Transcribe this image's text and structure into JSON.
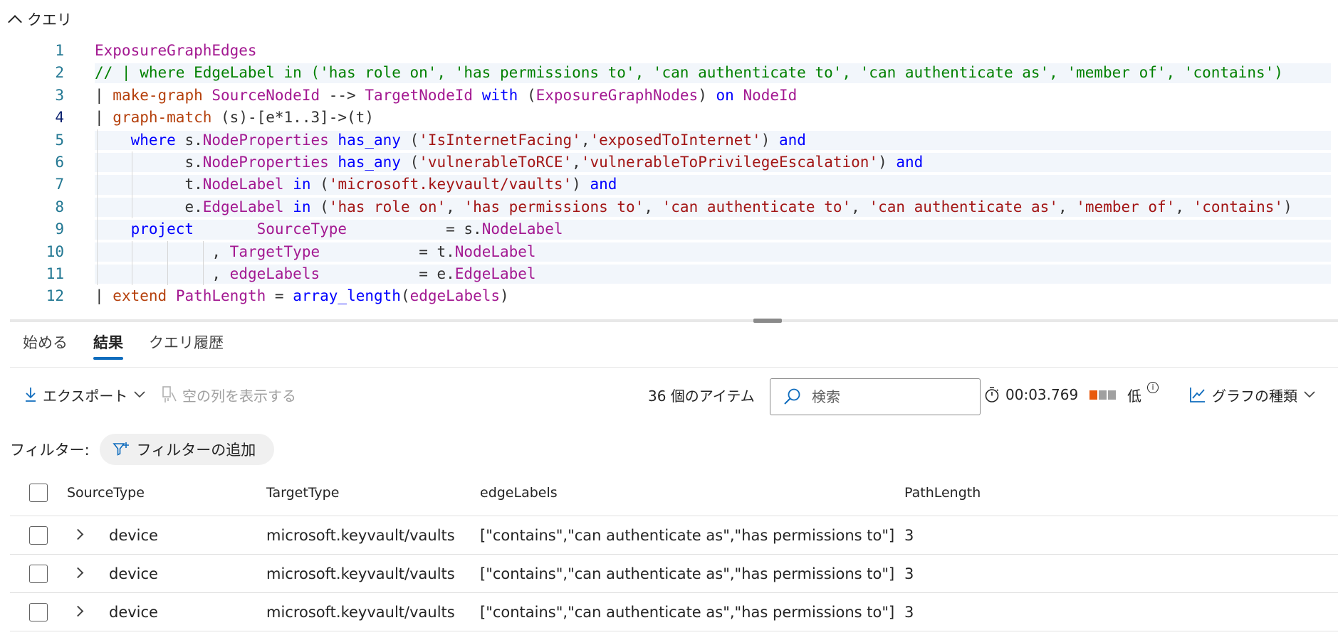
{
  "query_section": {
    "title": "クエリ"
  },
  "editor": {
    "line_numbers": [
      "1",
      "2",
      "3",
      "4",
      "5",
      "6",
      "7",
      "8",
      "9",
      "10",
      "11",
      "12"
    ]
  },
  "tabs": [
    "始める",
    "結果",
    "クエリ履歴"
  ],
  "toolbar": {
    "export_label": "エクスポート",
    "show_empty_columns_label": "空の列を表示する",
    "item_count": "36 個のアイテム",
    "search_placeholder": "検索",
    "elapsed_time": "00:03.769",
    "cost_label": "低",
    "chart_type_label": "グラフの種類"
  },
  "colors": {
    "accent": "#0f6cbd",
    "cost_high": "#e8590c",
    "cost_off": "#a0a0a0"
  },
  "filter": {
    "label": "フィルター:",
    "add_label": "フィルターの追加"
  },
  "table": {
    "columns": [
      "SourceType",
      "TargetType",
      "edgeLabels",
      "PathLength"
    ],
    "rows": [
      {
        "source": "device",
        "target": "microsoft.keyvault/vaults",
        "edges": "[\"contains\",\"can authenticate as\",\"has permissions to\"]",
        "length": "3"
      },
      {
        "source": "device",
        "target": "microsoft.keyvault/vaults",
        "edges": "[\"contains\",\"can authenticate as\",\"has permissions to\"]",
        "length": "3"
      },
      {
        "source": "device",
        "target": "microsoft.keyvault/vaults",
        "edges": "[\"contains\",\"can authenticate as\",\"has permissions to\"]",
        "length": "3"
      }
    ]
  }
}
